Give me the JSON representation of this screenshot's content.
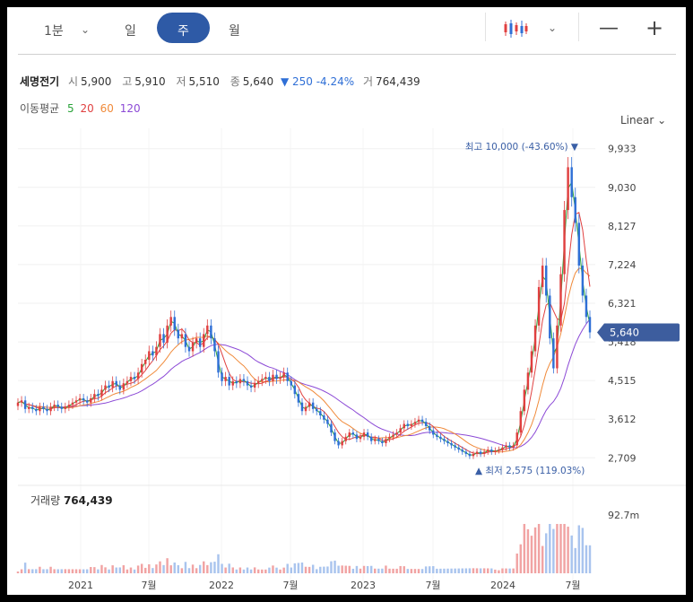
{
  "toolbar": {
    "interval": "1분",
    "periods": [
      "일",
      "주",
      "월"
    ],
    "active_period": "주"
  },
  "stock": {
    "name": "세명전기",
    "open_label": "시",
    "open": "5,900",
    "high_label": "고",
    "high": "5,910",
    "low_label": "저",
    "low": "5,510",
    "close_label": "종",
    "close": "5,640",
    "change": "▼ 250 -4.24%",
    "volume_label": "거",
    "volume": "764,439"
  },
  "ma": {
    "label": "이동평균",
    "items": [
      {
        "period": "5",
        "color": "#2aa33a"
      },
      {
        "period": "20",
        "color": "#e04040"
      },
      {
        "period": "60",
        "color": "#f08a3a"
      },
      {
        "period": "120",
        "color": "#8c4ad6"
      }
    ]
  },
  "scale": {
    "label": "Linear",
    "icon": "chevron-down-icon"
  },
  "colors": {
    "up": "#e04040",
    "down": "#2f6fd6",
    "accent": "#2e5aa6"
  },
  "chart_data": {
    "type": "candlestick",
    "x_ticks": [
      "2021",
      "7월",
      "2022",
      "7월",
      "2023",
      "7월",
      "2024",
      "7월"
    ],
    "y_ticks": [
      "9,933",
      "9,030",
      "8,127",
      "7,224",
      "6,321",
      "5,418",
      "4,515",
      "3,612",
      "2,709"
    ],
    "ylim": [
      2400,
      10200
    ],
    "current_price_label": "5,640",
    "max_annotation": "최고 10,000 (-43.60%) ▼",
    "min_annotation": "▲ 최저 2,575 (119.03%)",
    "volume_title": "거래량",
    "volume_value": "764,439",
    "volume_axis_label": "92.7m",
    "close_series": [
      4000,
      4050,
      3850,
      3900,
      3850,
      3800,
      3900,
      3850,
      3800,
      3900,
      3950,
      3900,
      3850,
      3900,
      3950,
      4000,
      4050,
      4100,
      4050,
      4000,
      4100,
      4200,
      4150,
      4300,
      4400,
      4350,
      4500,
      4400,
      4300,
      4450,
      4500,
      4600,
      4550,
      4700,
      4900,
      5000,
      5200,
      5100,
      5300,
      5600,
      5400,
      5800,
      6000,
      5700,
      5500,
      5600,
      5300,
      5200,
      5400,
      5500,
      5300,
      5600,
      5800,
      5500,
      5200,
      4700,
      4500,
      4600,
      4400,
      4500,
      4450,
      4550,
      4500,
      4400,
      4350,
      4450,
      4500,
      4550,
      4600,
      4500,
      4650,
      4550,
      4600,
      4700,
      4500,
      4400,
      4200,
      4000,
      3800,
      3900,
      4000,
      3850,
      3800,
      3700,
      3600,
      3500,
      3300,
      3100,
      3000,
      3100,
      3200,
      3300,
      3250,
      3150,
      3200,
      3300,
      3200,
      3100,
      3150,
      3100,
      3050,
      3150,
      3200,
      3250,
      3300,
      3400,
      3500,
      3450,
      3500,
      3550,
      3600,
      3550,
      3450,
      3350,
      3250,
      3200,
      3150,
      3100,
      3050,
      3000,
      2950,
      2900,
      2850,
      2800,
      2750,
      2800,
      2850,
      2800,
      2850,
      2900,
      2850,
      2880,
      2900,
      2950,
      3000,
      2950,
      3000,
      3300,
      3800,
      4300,
      4700,
      5200,
      5800,
      6700,
      7200,
      6500,
      5500,
      4800,
      5800,
      7000,
      8500,
      9500,
      8800,
      8200,
      7200,
      6500,
      6000,
      5640
    ]
  }
}
